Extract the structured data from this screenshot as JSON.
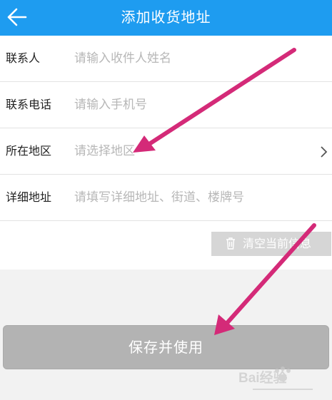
{
  "header": {
    "title": "添加收货地址"
  },
  "form": {
    "contact": {
      "label": "联系人",
      "placeholder": "请输入收件人姓名"
    },
    "phone": {
      "label": "联系电话",
      "placeholder": "请输入手机号"
    },
    "region": {
      "label": "所在地区",
      "placeholder": "请选择地区"
    },
    "address": {
      "label": "详细地址",
      "placeholder": "请填写详细地址、街道、楼牌号"
    }
  },
  "clear_button": {
    "label": "清空当前信息"
  },
  "save_button": {
    "label": "保存并使用"
  },
  "watermark": {
    "text": "Bai经验"
  },
  "colors": {
    "header": "#1e9cf0",
    "annotation_arrow": "#d42a78",
    "button": "#b3b3b3"
  }
}
